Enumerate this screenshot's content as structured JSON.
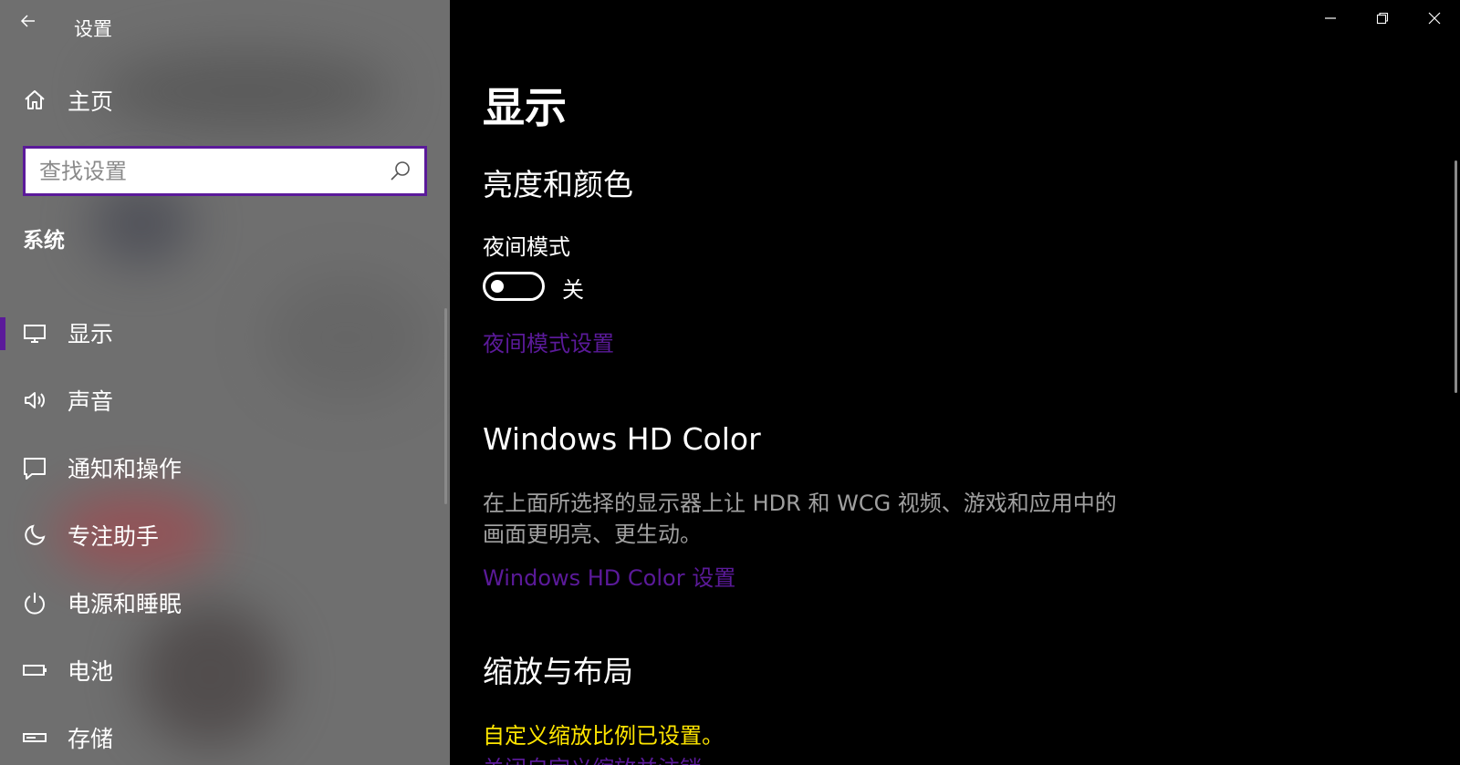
{
  "window": {
    "title": "设置"
  },
  "sidebar": {
    "home_label": "主页",
    "search_placeholder": "查找设置",
    "section_title": "系统",
    "items": [
      {
        "label": "显示",
        "icon": "monitor-icon",
        "active": true
      },
      {
        "label": "声音",
        "icon": "speaker-icon",
        "active": false
      },
      {
        "label": "通知和操作",
        "icon": "notification-icon",
        "active": false
      },
      {
        "label": "专注助手",
        "icon": "moon-icon",
        "active": false
      },
      {
        "label": "电源和睡眠",
        "icon": "power-icon",
        "active": false
      },
      {
        "label": "电池",
        "icon": "battery-icon",
        "active": false
      },
      {
        "label": "存储",
        "icon": "storage-icon",
        "active": false
      }
    ]
  },
  "main": {
    "page_title": "显示",
    "brightness": {
      "heading": "亮度和颜色",
      "night_light_label": "夜间模式",
      "night_light_state": "关",
      "night_light_on": false,
      "night_light_link": "夜间模式设置"
    },
    "hd_color": {
      "heading": "Windows HD Color",
      "description": "在上面所选择的显示器上让 HDR 和 WCG 视频、游戏和应用中的画面更明亮、更生动。",
      "link": "Windows HD Color 设置"
    },
    "scale": {
      "heading": "缩放与布局",
      "warning": "自定义缩放比例已设置。",
      "link": "关闭自定义缩放并注销"
    }
  },
  "colors": {
    "accent": "#5b1a9a",
    "warning": "#ffe600",
    "sidebar_bg": "#6f6f6f",
    "main_bg": "#000000"
  }
}
